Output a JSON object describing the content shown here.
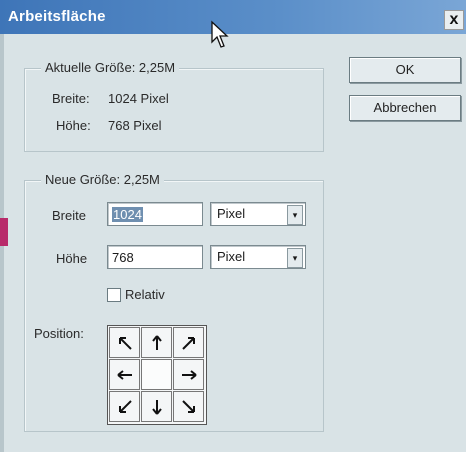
{
  "window": {
    "title": "Arbeitsfläche",
    "close_glyph": "x"
  },
  "current_size": {
    "header": "Aktuelle Größe: 2,25M",
    "width_label": "Breite:",
    "width_value": "1024 Pixel",
    "height_label": "Höhe:",
    "height_value": "768 Pixel"
  },
  "new_size": {
    "header": "Neue Größe: 2,25M",
    "width_label": "Breite",
    "width_value": "1024",
    "width_unit": "Pixel",
    "height_label": "Höhe",
    "height_value": "768",
    "height_unit": "Pixel",
    "relative_label": "Relativ",
    "relative_checked": false,
    "position_label": "Position:",
    "anchor_cells": [
      "arrow-up-left-icon",
      "arrow-up-icon",
      "arrow-up-right-icon",
      "arrow-left-icon",
      "anchor-center",
      "arrow-right-icon",
      "arrow-down-left-icon",
      "arrow-down-icon",
      "arrow-down-right-icon"
    ]
  },
  "buttons": {
    "ok": "OK",
    "cancel": "Abbrechen"
  }
}
